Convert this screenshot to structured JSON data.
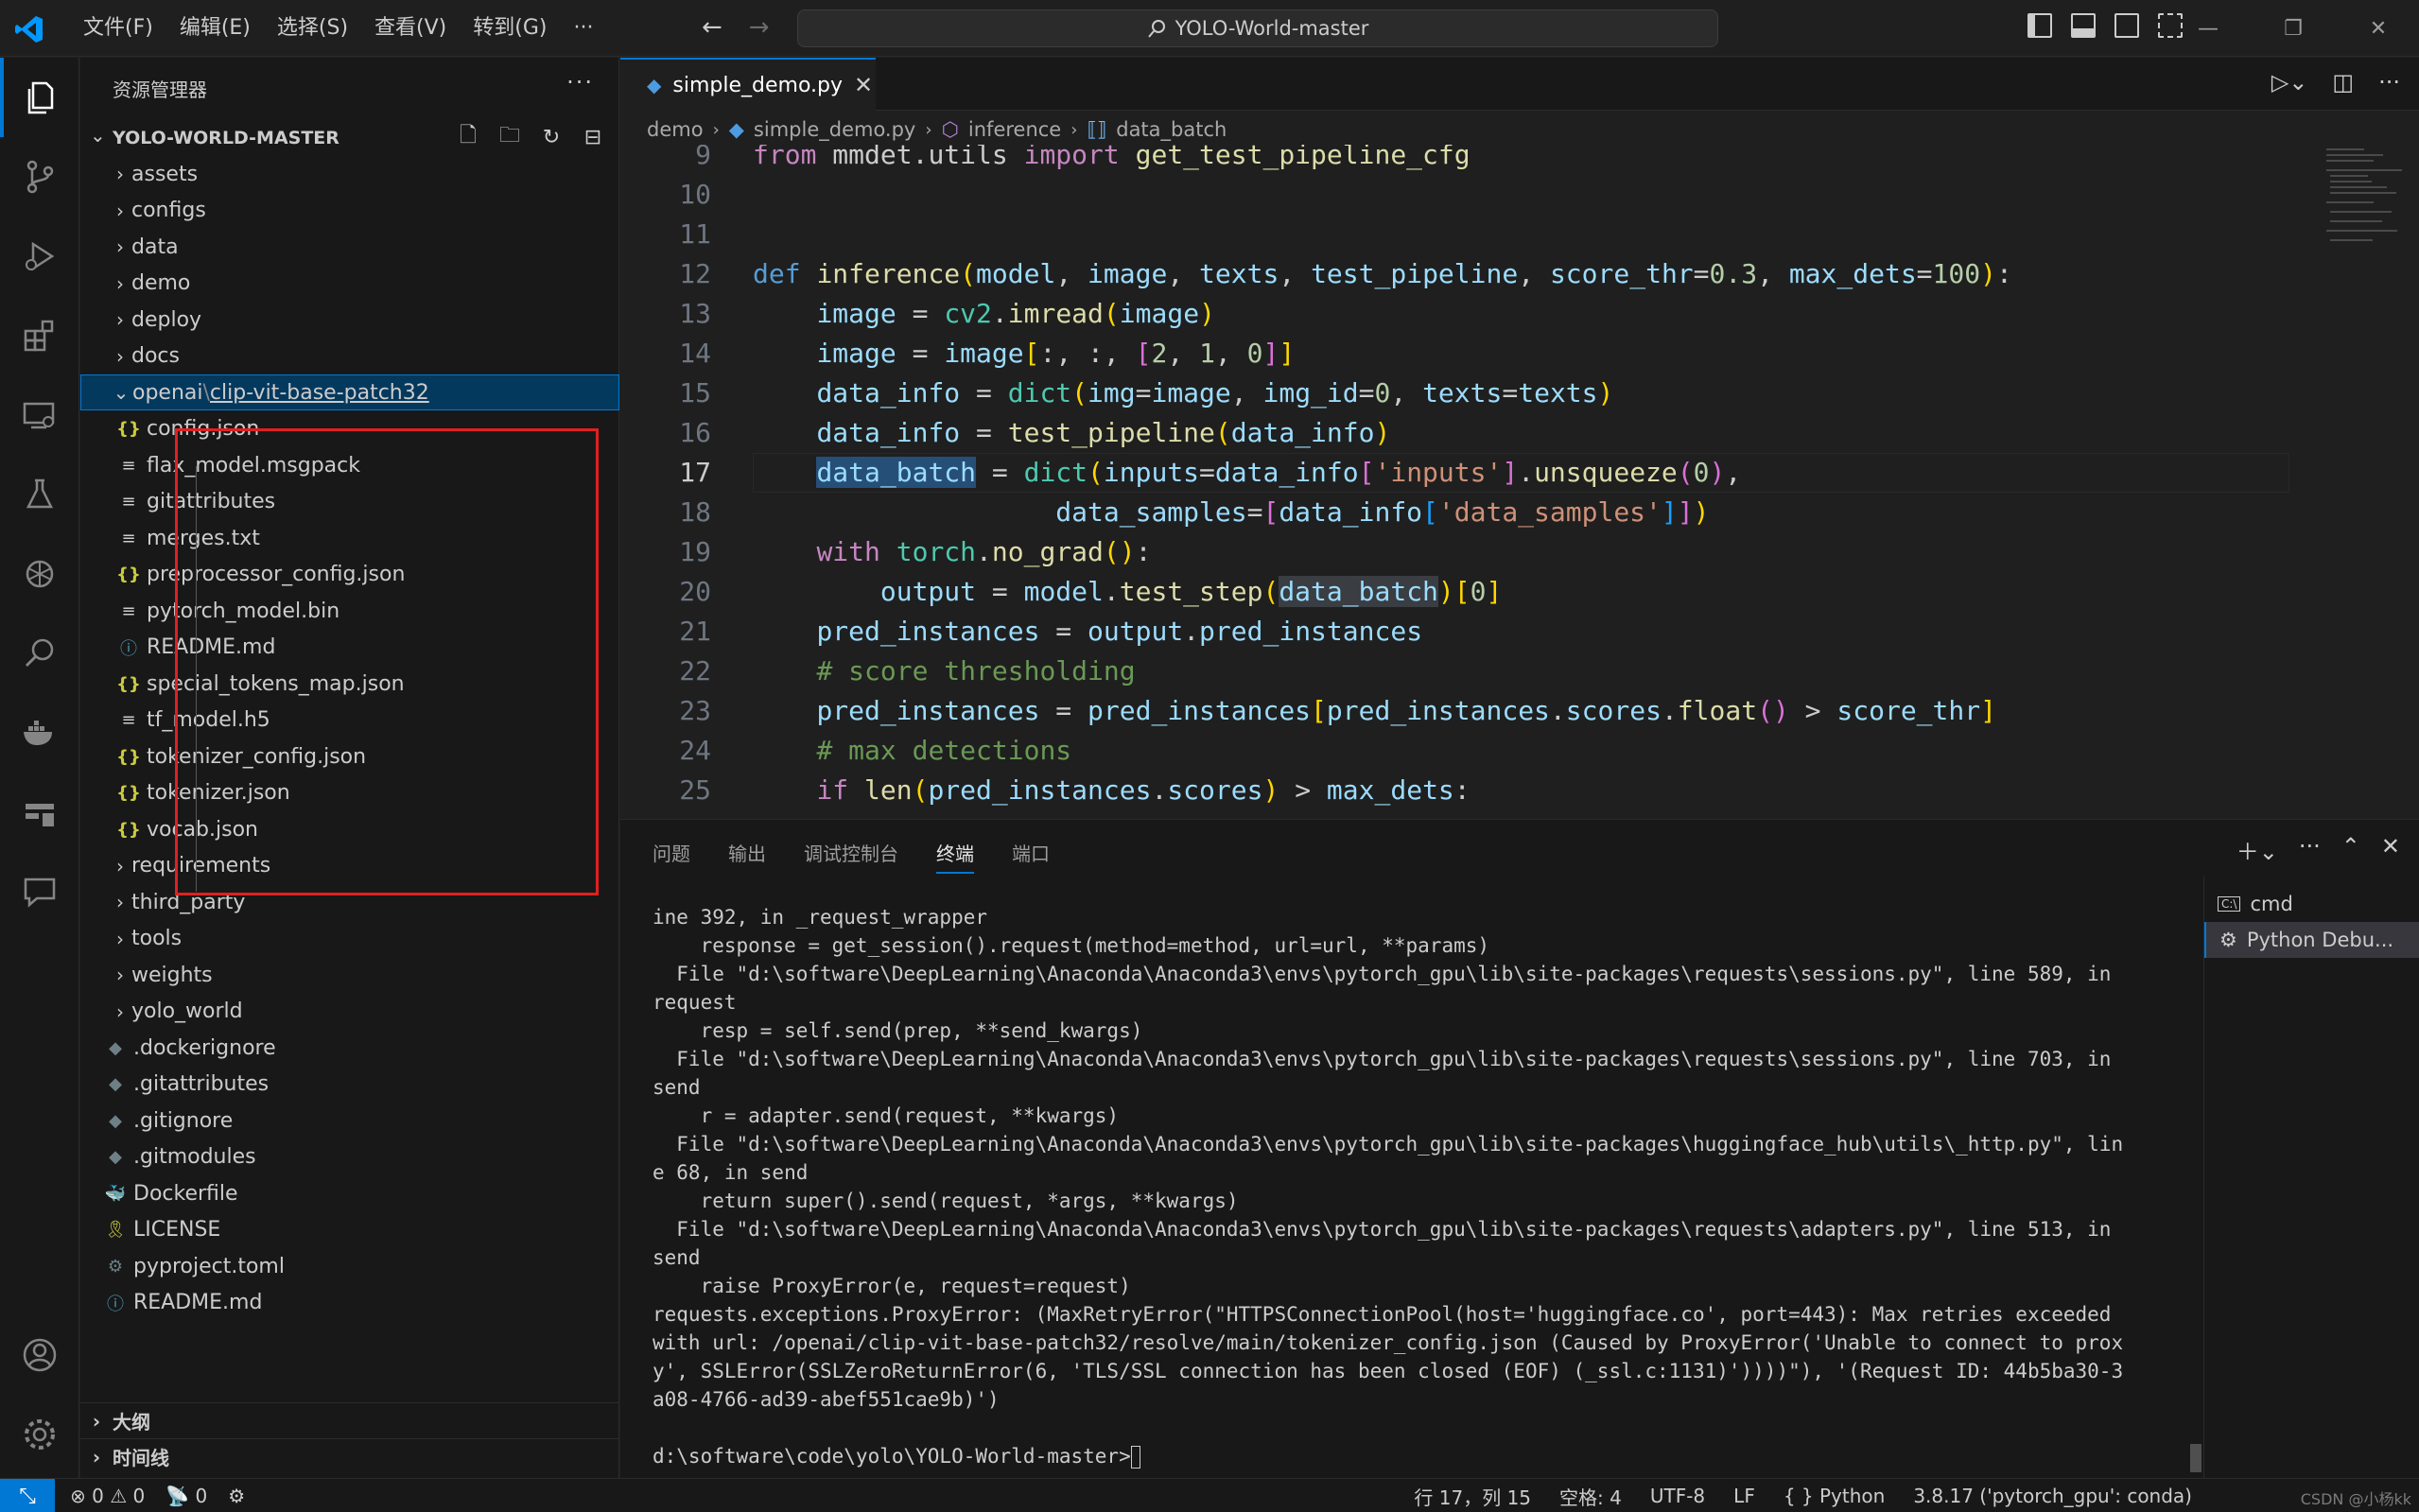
{
  "window": {
    "menu": [
      "文件(F)",
      "编辑(E)",
      "选择(S)",
      "查看(V)",
      "转到(G)",
      "···"
    ],
    "search_title": "YOLO-World-master"
  },
  "sidebar": {
    "title": "资源管理器",
    "more": "···",
    "root": "YOLO-WORLD-MASTER",
    "items": [
      {
        "label": "assets",
        "type": "folder"
      },
      {
        "label": "configs",
        "type": "folder"
      },
      {
        "label": "data",
        "type": "folder"
      },
      {
        "label": "demo",
        "type": "folder"
      },
      {
        "label": "deploy",
        "type": "folder"
      },
      {
        "label": "docs",
        "type": "folder"
      }
    ],
    "selected_folder": {
      "prefix": "openai",
      "sep": "\\",
      "name": "clip-vit-base-patch32"
    },
    "sub_items": [
      {
        "label": "config.json",
        "icon": "{}"
      },
      {
        "label": "flax_model.msgpack",
        "icon": "≡"
      },
      {
        "label": "gitattributes",
        "icon": "≡"
      },
      {
        "label": "merges.txt",
        "icon": "≡"
      },
      {
        "label": "preprocessor_config.json",
        "icon": "{}"
      },
      {
        "label": "pytorch_model.bin",
        "icon": "≡"
      },
      {
        "label": "README.md",
        "icon": "ⓘ"
      },
      {
        "label": "special_tokens_map.json",
        "icon": "{}"
      },
      {
        "label": "tf_model.h5",
        "icon": "≡"
      },
      {
        "label": "tokenizer_config.json",
        "icon": "{}"
      },
      {
        "label": "tokenizer.json",
        "icon": "{}"
      },
      {
        "label": "vocab.json",
        "icon": "{}"
      }
    ],
    "items_after": [
      {
        "label": "requirements",
        "type": "folder"
      },
      {
        "label": "third_party",
        "type": "folder"
      },
      {
        "label": "tools",
        "type": "folder"
      },
      {
        "label": "weights",
        "type": "folder"
      },
      {
        "label": "yolo_world",
        "type": "folder"
      }
    ],
    "root_files": [
      {
        "label": ".dockerignore",
        "icon": "◆"
      },
      {
        "label": ".gitattributes",
        "icon": "◆"
      },
      {
        "label": ".gitignore",
        "icon": "◆"
      },
      {
        "label": ".gitmodules",
        "icon": "◆"
      },
      {
        "label": "Dockerfile",
        "icon": "🐳"
      },
      {
        "label": "LICENSE",
        "icon": "🎗"
      },
      {
        "label": "pyproject.toml",
        "icon": "⚙"
      },
      {
        "label": "README.md",
        "icon": "ⓘ"
      }
    ],
    "outline": "大纲",
    "timeline": "时间线"
  },
  "editor": {
    "tab": "simple_demo.py",
    "breadcrumb": [
      "demo",
      "simple_demo.py",
      "inference",
      "data_batch"
    ],
    "line_numbers": [
      "9",
      "10",
      "11",
      "12",
      "13",
      "14",
      "15",
      "16",
      "17",
      "18",
      "19",
      "20",
      "21",
      "22",
      "23",
      "24",
      "25"
    ],
    "current_line": "17"
  },
  "panel": {
    "tabs": [
      "问题",
      "输出",
      "调试控制台",
      "终端",
      "端口"
    ],
    "active_tab": "终端",
    "terminal_lines": [
      "ine 392, in _request_wrapper",
      "    response = get_session().request(method=method, url=url, **params)",
      "  File \"d:\\software\\DeepLearning\\Anaconda\\Anaconda3\\envs\\pytorch_gpu\\lib\\site-packages\\requests\\sessions.py\", line 589, in",
      "request",
      "    resp = self.send(prep, **send_kwargs)",
      "  File \"d:\\software\\DeepLearning\\Anaconda\\Anaconda3\\envs\\pytorch_gpu\\lib\\site-packages\\requests\\sessions.py\", line 703, in",
      "send",
      "    r = adapter.send(request, **kwargs)",
      "  File \"d:\\software\\DeepLearning\\Anaconda\\Anaconda3\\envs\\pytorch_gpu\\lib\\site-packages\\huggingface_hub\\utils\\_http.py\", lin",
      "e 68, in send",
      "    return super().send(request, *args, **kwargs)",
      "  File \"d:\\software\\DeepLearning\\Anaconda\\Anaconda3\\envs\\pytorch_gpu\\lib\\site-packages\\requests\\adapters.py\", line 513, in",
      "send",
      "    raise ProxyError(e, request=request)",
      "requests.exceptions.ProxyError: (MaxRetryError(\"HTTPSConnectionPool(host='huggingface.co', port=443): Max retries exceeded",
      "with url: /openai/clip-vit-base-patch32/resolve/main/tokenizer_config.json (Caused by ProxyError('Unable to connect to prox",
      "y', SSLError(SSLZeroReturnError(6, 'TLS/SSL connection has been closed (EOF) (_ssl.c:1131)'))))\"), '(Request ID: 44b5ba30-3",
      "a08-4766-ad39-abef551cae9b)')",
      "",
      "d:\\software\\code\\yolo\\YOLO-World-master>"
    ],
    "terminals": [
      "cmd",
      "Python Debu..."
    ]
  },
  "status": {
    "errors": "0",
    "warnings": "0",
    "ports": "0",
    "position": "行 17，列 15",
    "spaces": "空格: 4",
    "encoding": "UTF-8",
    "eol": "LF",
    "language": "Python",
    "interpreter": "3.8.17 ('pytorch_gpu': conda)",
    "watermark": "CSDN @小杨kk"
  },
  "colors": {
    "accent": "#0078d4",
    "highlight_box": "#e02020"
  }
}
